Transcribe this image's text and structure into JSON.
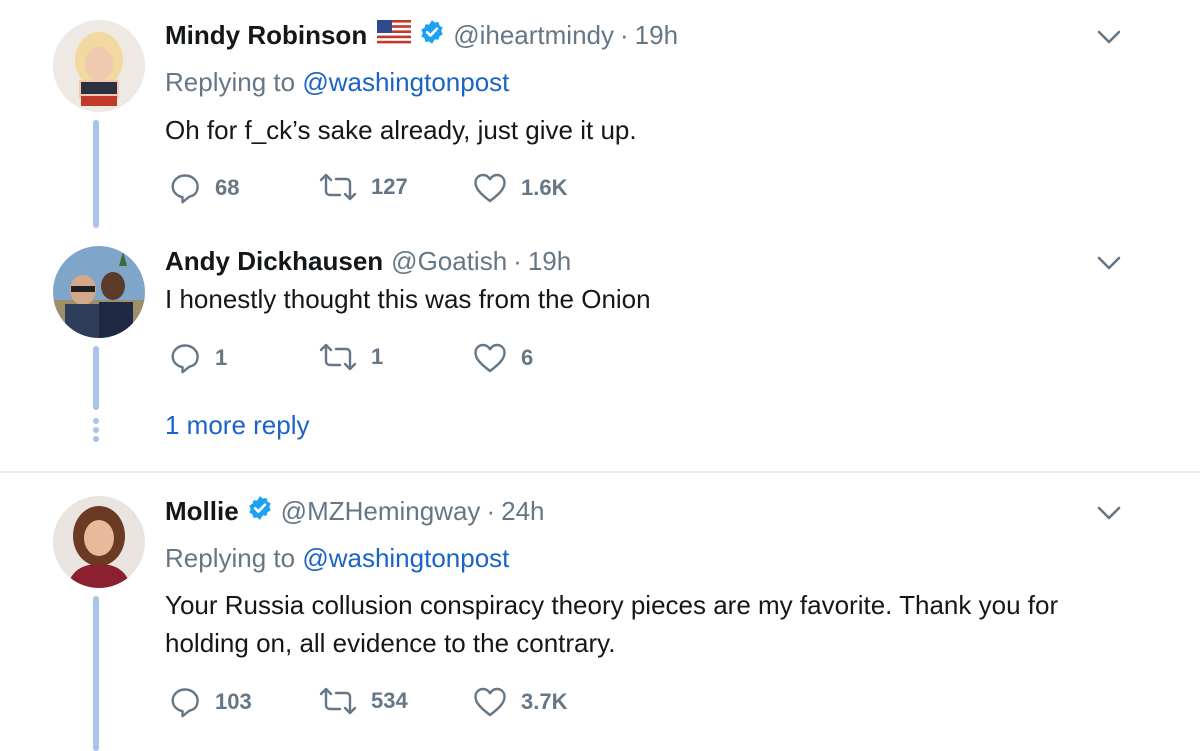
{
  "tweets": [
    {
      "name": "Mindy Robinson",
      "handle": "@iheartmindy",
      "sep": "·",
      "time": "19h",
      "replying_prefix": "Replying to ",
      "replying_to": "@washingtonpost",
      "text": "Oh for f_ck’s sake already, just give it up.",
      "replies": "68",
      "retweets": "127",
      "likes": "1.6K"
    },
    {
      "name": "Andy Dickhausen",
      "handle": "@Goatish",
      "sep": "·",
      "time": "19h",
      "text": "I honestly thought this was from the Onion",
      "replies": "1",
      "retweets": "1",
      "likes": "6"
    },
    {
      "name": "Mollie",
      "handle": "@MZHemingway",
      "sep": "·",
      "time": "24h",
      "replying_prefix": "Replying to ",
      "replying_to": "@washingtonpost",
      "text_line1": "Your Russia collusion conspiracy theory pieces are my favorite. Thank you for",
      "text_line2": "holding on, all evidence to the contrary.",
      "replies": "103",
      "retweets": "534",
      "likes": "3.7K"
    }
  ],
  "more_reply": "1 more reply",
  "icons": {
    "reply": "reply-icon",
    "retweet": "retweet-icon",
    "like": "like-icon",
    "caret": "chevron-down-icon",
    "verified": "verified-badge-icon",
    "flag": "us-flag-icon"
  },
  "colors": {
    "link": "#1b63c7",
    "muted": "#657786",
    "verified": "#1da1f2",
    "thread": "#a9c4ec"
  }
}
